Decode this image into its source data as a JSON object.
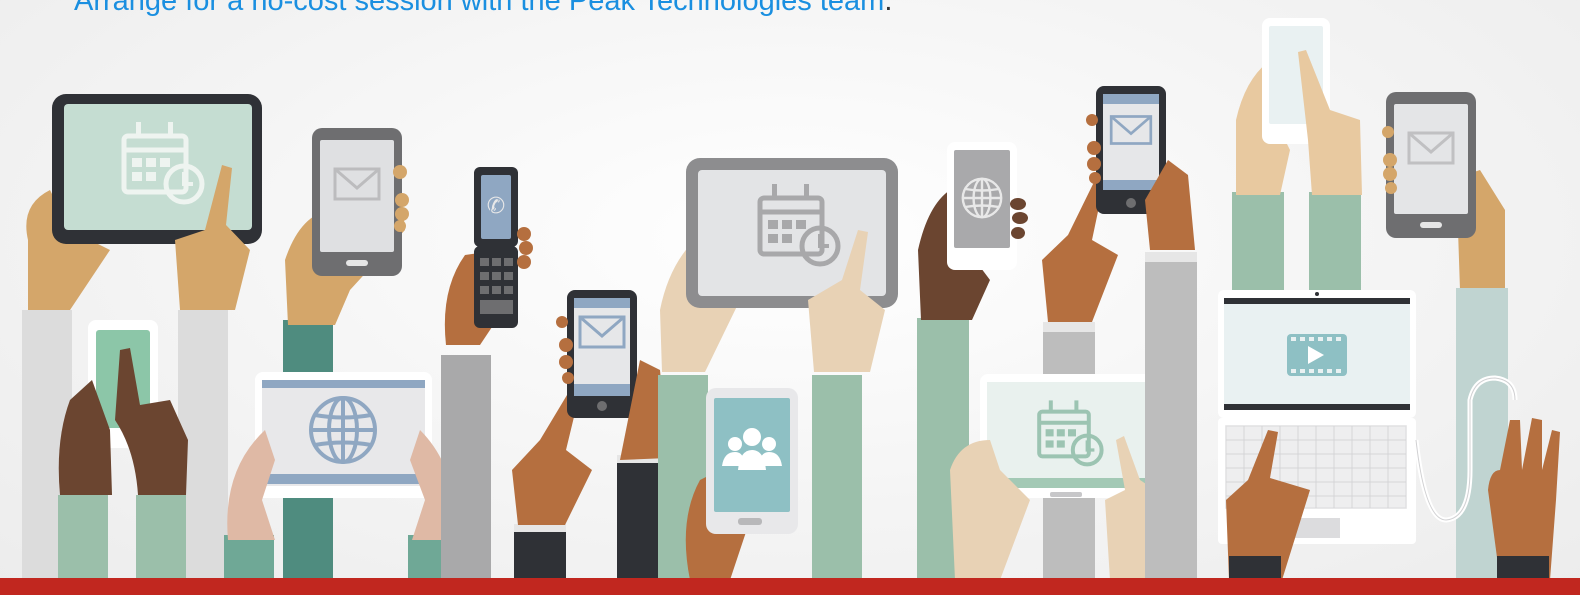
{
  "header": {
    "cta_text": "Arrange for a no-cost session with the Peak Technologies team",
    "cta_period": "."
  },
  "colors": {
    "link": "#1a8fe0",
    "bottom_bar": "#c1271f",
    "skin_light": "#e8d2b5",
    "skin_medium": "#d4a66a",
    "skin_tan": "#b56f3f",
    "skin_dark": "#6b4530",
    "sleeve_green": "#9bbfaa",
    "sleeve_teal": "#4f8c7f",
    "sleeve_grey": "#bdbdbd",
    "device_dark": "#2f3136"
  },
  "icons": [
    "calendar-clock-icon",
    "envelope-icon",
    "phone-call-icon",
    "globe-icon",
    "group-users-icon",
    "video-play-icon"
  ]
}
